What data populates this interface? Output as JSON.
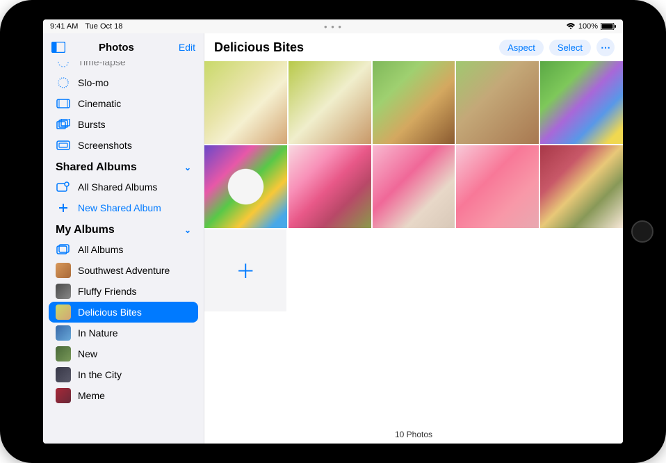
{
  "statusbar": {
    "time": "9:41 AM",
    "date": "Tue Oct 18",
    "battery": "100%"
  },
  "sidebar": {
    "title": "Photos",
    "edit": "Edit",
    "mediaTypes": [
      {
        "label": "Time-lapse",
        "icon": "timelapse"
      },
      {
        "label": "Slo-mo",
        "icon": "slomo"
      },
      {
        "label": "Cinematic",
        "icon": "cinematic"
      },
      {
        "label": "Bursts",
        "icon": "bursts"
      },
      {
        "label": "Screenshots",
        "icon": "screenshots"
      }
    ],
    "sharedSection": "Shared Albums",
    "shared": [
      {
        "label": "All Shared Albums",
        "icon": "shared-albums"
      },
      {
        "label": "New Shared Album",
        "icon": "plus",
        "accent": true
      }
    ],
    "myAlbumsSection": "My Albums",
    "myAlbums": [
      {
        "label": "All Albums",
        "icon": "albums"
      },
      {
        "label": "Southwest Adventure",
        "thumb": "t-sw"
      },
      {
        "label": "Fluffy Friends",
        "thumb": "t-ff"
      },
      {
        "label": "Delicious Bites",
        "thumb": "t-db",
        "selected": true
      },
      {
        "label": "In Nature",
        "thumb": "t-in"
      },
      {
        "label": "New",
        "thumb": "t-nw"
      },
      {
        "label": "In the City",
        "thumb": "t-ic"
      },
      {
        "label": "Meme",
        "thumb": "t-mm"
      }
    ]
  },
  "content": {
    "title": "Delicious Bites",
    "aspectBtn": "Aspect",
    "selectBtn": "Select",
    "photoCount": "10 Photos",
    "photos": [
      "p1",
      "p2",
      "p3",
      "p4",
      "p5",
      "p6",
      "p7",
      "p8",
      "p9",
      "p10"
    ]
  }
}
